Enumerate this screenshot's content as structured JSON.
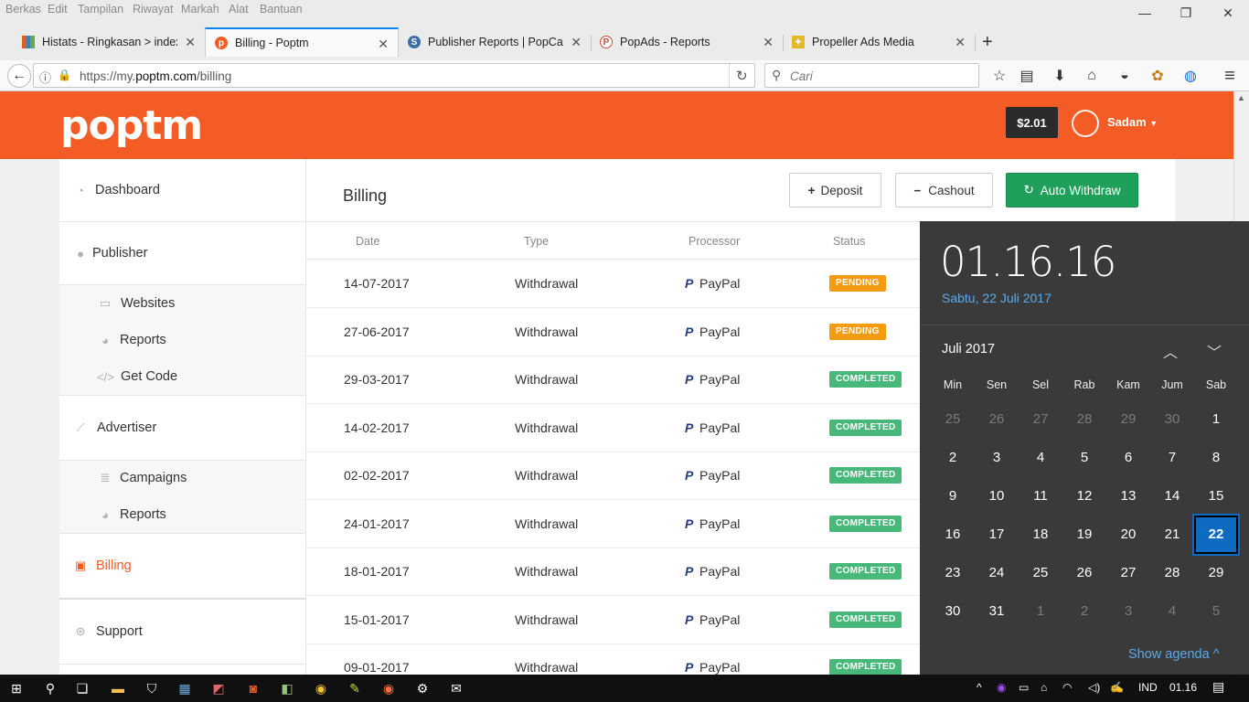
{
  "menu": [
    "Berkas",
    "Edit",
    "Tampilan",
    "Riwayat",
    "Markah",
    "Alat",
    "Bantuan"
  ],
  "tabs": [
    {
      "title": "Histats - Ringkasan > indexn",
      "active": false,
      "color": "#e0611a"
    },
    {
      "title": "Billing - Poptm",
      "active": true,
      "color": "#f45c25"
    },
    {
      "title": "Publisher Reports | PopCash",
      "active": false,
      "color": "#3a6ea5"
    },
    {
      "title": "PopAds - Reports",
      "active": false,
      "color": "#c94a3a"
    },
    {
      "title": "Propeller Ads Media",
      "active": false,
      "color": "#e7b72a"
    }
  ],
  "url": {
    "prefix": "https://my.",
    "domain": "poptm.com",
    "path": "/billing"
  },
  "search_placeholder": "Cari",
  "header": {
    "logo": "poptm",
    "balance": "$2.01",
    "username": "Sadam"
  },
  "sidebar": {
    "dashboard": "Dashboard",
    "publisher": "Publisher",
    "websites": "Websites",
    "reports1": "Reports",
    "getcode": "Get Code",
    "advertiser": "Advertiser",
    "campaigns": "Campaigns",
    "reports2": "Reports",
    "billing": "Billing",
    "support": "Support"
  },
  "page": {
    "title": "Billing",
    "deposit": "Deposit",
    "cashout": "Cashout",
    "autowithdraw": "Auto Withdraw"
  },
  "table": {
    "headers": {
      "date": "Date",
      "type": "Type",
      "processor": "Processor",
      "status": "Status"
    },
    "rows": [
      {
        "date": "14-07-2017",
        "type": "Withdrawal",
        "processor": "PayPal",
        "status": "PENDING"
      },
      {
        "date": "27-06-2017",
        "type": "Withdrawal",
        "processor": "PayPal",
        "status": "PENDING"
      },
      {
        "date": "29-03-2017",
        "type": "Withdrawal",
        "processor": "PayPal",
        "status": "COMPLETED"
      },
      {
        "date": "14-02-2017",
        "type": "Withdrawal",
        "processor": "PayPal",
        "status": "COMPLETED"
      },
      {
        "date": "02-02-2017",
        "type": "Withdrawal",
        "processor": "PayPal",
        "status": "COMPLETED"
      },
      {
        "date": "24-01-2017",
        "type": "Withdrawal",
        "processor": "PayPal",
        "status": "COMPLETED"
      },
      {
        "date": "18-01-2017",
        "type": "Withdrawal",
        "processor": "PayPal",
        "status": "COMPLETED"
      },
      {
        "date": "15-01-2017",
        "type": "Withdrawal",
        "processor": "PayPal",
        "status": "COMPLETED"
      },
      {
        "date": "09-01-2017",
        "type": "Withdrawal",
        "processor": "PayPal",
        "status": "COMPLETED"
      }
    ]
  },
  "calendar": {
    "time": "01.16.16",
    "long_date": "Sabtu, 22 Juli 2017",
    "month": "Juli 2017",
    "weekdays": [
      "Min",
      "Sen",
      "Sel",
      "Rab",
      "Kam",
      "Jum",
      "Sab"
    ],
    "days": [
      [
        "25",
        "26",
        "27",
        "28",
        "29",
        "30",
        "1"
      ],
      [
        "2",
        "3",
        "4",
        "5",
        "6",
        "7",
        "8"
      ],
      [
        "9",
        "10",
        "11",
        "12",
        "13",
        "14",
        "15"
      ],
      [
        "16",
        "17",
        "18",
        "19",
        "20",
        "21",
        "22"
      ],
      [
        "23",
        "24",
        "25",
        "26",
        "27",
        "28",
        "29"
      ],
      [
        "30",
        "31",
        "1",
        "2",
        "3",
        "4",
        "5"
      ]
    ],
    "dim": [
      [
        true,
        true,
        true,
        true,
        true,
        true,
        false
      ],
      [
        false,
        false,
        false,
        false,
        false,
        false,
        false
      ],
      [
        false,
        false,
        false,
        false,
        false,
        false,
        false
      ],
      [
        false,
        false,
        false,
        false,
        false,
        false,
        false
      ],
      [
        false,
        false,
        false,
        false,
        false,
        false,
        false
      ],
      [
        false,
        false,
        true,
        true,
        true,
        true,
        true
      ]
    ],
    "today": "22",
    "show_agenda": "Show agenda"
  },
  "tray": {
    "lang": "IND",
    "time": "01.16"
  }
}
